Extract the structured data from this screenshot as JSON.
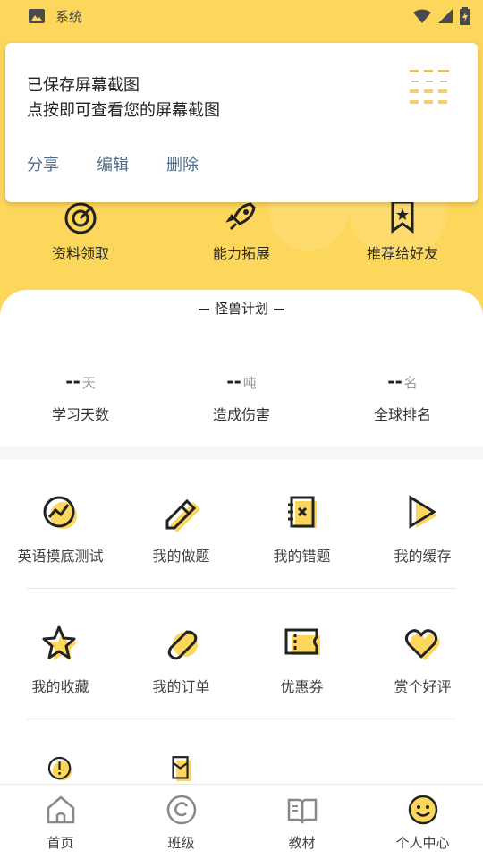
{
  "status_bar": {
    "app_label": "系统"
  },
  "notification": {
    "line1": "已保存屏幕截图",
    "line2": "点按即可查看您的屏幕截图",
    "actions": [
      "分享",
      "编辑",
      "删除"
    ]
  },
  "shortcuts": [
    {
      "label": "资料领取",
      "icon": "target-icon"
    },
    {
      "label": "能力拓展",
      "icon": "rocket-icon"
    },
    {
      "label": "推荐给好友",
      "icon": "bookmark-star-icon"
    }
  ],
  "stats_card": {
    "title": "怪兽计划",
    "stats": [
      {
        "value": "--",
        "unit": "天",
        "name": "学习天数"
      },
      {
        "value": "--",
        "unit": "吨",
        "name": "造成伤害"
      },
      {
        "value": "--",
        "unit": "名",
        "name": "全球排名"
      }
    ]
  },
  "grid": {
    "row1": [
      {
        "label": "英语摸底测试",
        "icon": "chart-circle-icon"
      },
      {
        "label": "我的做题",
        "icon": "pencil-icon"
      },
      {
        "label": "我的错题",
        "icon": "notebook-x-icon"
      },
      {
        "label": "我的缓存",
        "icon": "play-icon"
      }
    ],
    "row2": [
      {
        "label": "我的收藏",
        "icon": "star-icon"
      },
      {
        "label": "我的订单",
        "icon": "paperclip-icon"
      },
      {
        "label": "优惠券",
        "icon": "coupon-icon"
      },
      {
        "label": "赏个好评",
        "icon": "heart-icon"
      }
    ]
  },
  "bottom_nav": [
    {
      "label": "首页",
      "icon": "home-icon"
    },
    {
      "label": "班级",
      "icon": "class-icon"
    },
    {
      "label": "教材",
      "icon": "book-icon"
    },
    {
      "label": "个人中心",
      "icon": "smiley-icon",
      "active": true
    }
  ],
  "colors": {
    "accent_yellow": "#fdd65c",
    "action_blue": "#4f6d8a",
    "ink": "#222222"
  }
}
